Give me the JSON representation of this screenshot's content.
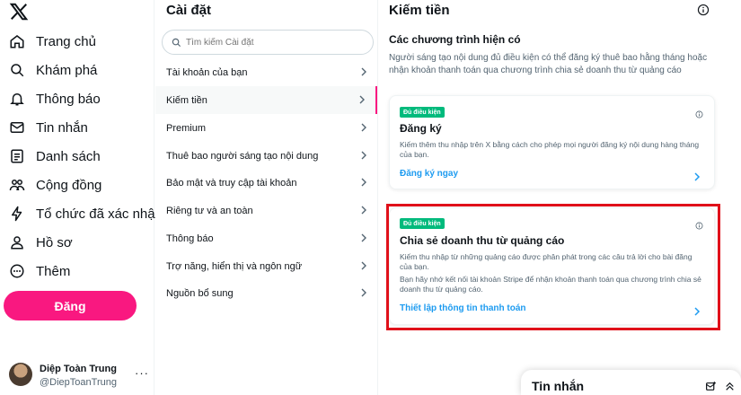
{
  "nav": {
    "items": [
      {
        "label": "Trang chủ",
        "icon": "home-icon"
      },
      {
        "label": "Khám phá",
        "icon": "search-icon"
      },
      {
        "label": "Thông báo",
        "icon": "bell-icon"
      },
      {
        "label": "Tin nhắn",
        "icon": "mail-icon"
      },
      {
        "label": "Danh sách",
        "icon": "list-icon"
      },
      {
        "label": "Cộng đồng",
        "icon": "community-icon"
      },
      {
        "label": "Tổ chức đã xác nhậ",
        "icon": "lightning-icon"
      },
      {
        "label": "Hồ sơ",
        "icon": "person-icon"
      },
      {
        "label": "Thêm",
        "icon": "more-circle-icon"
      }
    ],
    "post_label": "Đăng"
  },
  "profile": {
    "name": "Diệp Toàn Trung",
    "handle": "@DiepToanTrung",
    "more": "···"
  },
  "settings": {
    "title": "Cài đặt",
    "search_placeholder": "Tìm kiếm Cài đặt",
    "items": [
      {
        "label": "Tài khoản của bạn"
      },
      {
        "label": "Kiếm tiền"
      },
      {
        "label": "Premium"
      },
      {
        "label": "Thuê bao người sáng tạo nội dung"
      },
      {
        "label": "Bảo mật và truy cập tài khoản"
      },
      {
        "label": "Riêng tư và an toàn"
      },
      {
        "label": "Thông báo"
      },
      {
        "label": "Trợ năng, hiển thị và ngôn ngữ"
      },
      {
        "label": "Nguồn bổ sung"
      }
    ]
  },
  "main": {
    "title": "Kiếm tiền",
    "subtitle": "Các chương trình hiện có",
    "description": "Người sáng tạo nội dung đủ điều kiện có thể đăng ký thuê bao hằng tháng hoặc nhận khoản thanh toán qua chương trình chia sẻ doanh thu từ quảng cáo",
    "cards": [
      {
        "badge": "Đủ điều kiện",
        "title": "Đăng ký",
        "desc": "Kiếm thêm thu nhập trên X bằng cách cho phép mọi người đăng ký nội dung hàng tháng của bạn.",
        "desc2": "",
        "link": "Đăng ký ngay"
      },
      {
        "badge": "Đủ điều kiện",
        "title": "Chia sẻ doanh thu từ quảng cáo",
        "desc": "Kiếm thu nhập từ những quảng cáo được phân phát trong các câu trả lời cho bài đăng của bạn.",
        "desc2": "Bạn hãy nhớ kết nối tài khoản Stripe để nhận khoản thanh toán qua chương trình chia sẻ doanh thu từ quảng cáo.",
        "link": "Thiết lập thông tin thanh toán"
      }
    ]
  },
  "messages": {
    "title": "Tin nhắn"
  },
  "colors": {
    "accent": "#f91880",
    "link": "#1d9bf0",
    "badge": "#00ba7c",
    "highlight": "#e0101a"
  }
}
